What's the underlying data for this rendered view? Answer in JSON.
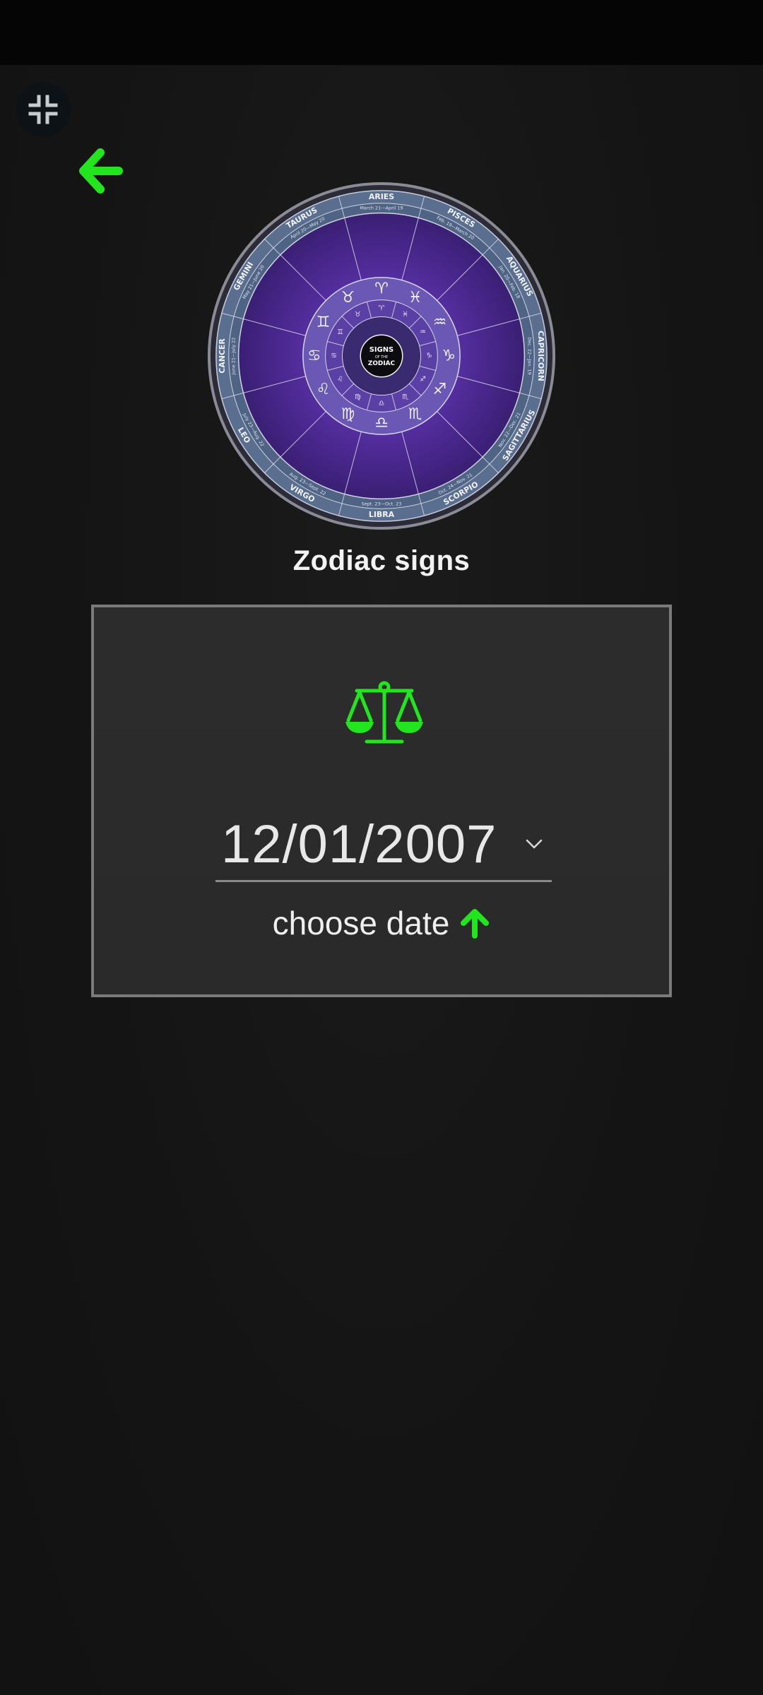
{
  "header": {
    "collapse_icon": "collapse-arrows-icon",
    "back_icon": "arrow-left-icon"
  },
  "wheel": {
    "center_lines": [
      "SIGNS",
      "OF THE",
      "ZODIAC"
    ],
    "signs": [
      "ARIES",
      "PISCES",
      "AQUARIUS",
      "CAPRICORN",
      "SAGITTARIUS",
      "SCORPIO",
      "LIBRA",
      "VIRGO",
      "LEO",
      "CANCER",
      "GEMINI",
      "TAURUS"
    ],
    "dates": [
      "March 21—April 19",
      "Feb. 19—March 20",
      "Jan. 20—Feb. 18",
      "Dec. 22—Jan. 19",
      "Nov. 22—Dec. 21",
      "Oct. 24—Nov. 21",
      "Sept. 23—Oct. 23",
      "Aug. 23—Sept. 22",
      "July 23—Aug. 22",
      "June 21—July 22",
      "May 21—June 20",
      "April 20—May 20"
    ],
    "glyphs": [
      "♈",
      "♓",
      "♒",
      "♑",
      "♐",
      "♏",
      "♎",
      "♍",
      "♌",
      "♋",
      "♊",
      "♉"
    ]
  },
  "page": {
    "title": "Zodiac signs"
  },
  "card": {
    "sign_icon": "libra-scales-icon",
    "date_value": "12/01/2007",
    "dropdown_icon": "chevron-down-icon",
    "helper_text": "choose date",
    "helper_icon": "arrow-up-icon"
  },
  "colors": {
    "accent": "#22e51f",
    "background": "#151515",
    "card": "#2b2b2b",
    "card_border": "#7a7a7a",
    "wheel_purple": "#4a2a8c"
  }
}
